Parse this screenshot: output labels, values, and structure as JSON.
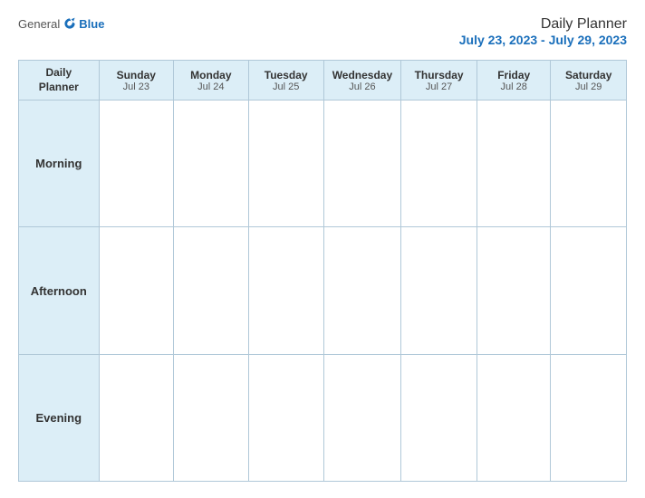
{
  "header": {
    "logo": {
      "general": "General",
      "blue": "Blue",
      "bird_symbol": "▶"
    },
    "title": "Daily Planner",
    "date_range": "July 23, 2023 - July 29, 2023"
  },
  "table": {
    "first_header": "Daily\nPlanner",
    "columns": [
      {
        "day": "Sunday",
        "date": "Jul 23"
      },
      {
        "day": "Monday",
        "date": "Jul 24"
      },
      {
        "day": "Tuesday",
        "date": "Jul 25"
      },
      {
        "day": "Wednesday",
        "date": "Jul 26"
      },
      {
        "day": "Thursday",
        "date": "Jul 27"
      },
      {
        "day": "Friday",
        "date": "Jul 28"
      },
      {
        "day": "Saturday",
        "date": "Jul 29"
      }
    ],
    "rows": [
      {
        "label": "Morning"
      },
      {
        "label": "Afternoon"
      },
      {
        "label": "Evening"
      }
    ]
  }
}
